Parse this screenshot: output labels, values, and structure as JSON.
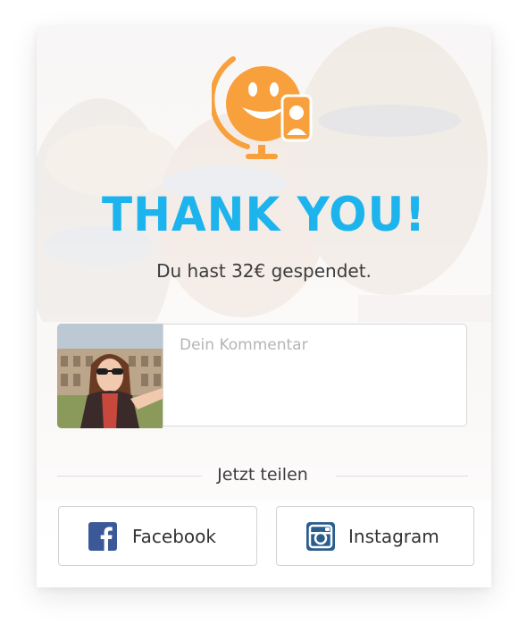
{
  "header": {
    "title": "THANK YOU!",
    "donation_text": "Du hast 32€ gespendet."
  },
  "comment": {
    "placeholder": "Dein Kommentar",
    "value": ""
  },
  "share": {
    "label": "Jetzt teilen",
    "facebook_label": "Facebook",
    "instagram_label": "Instagram"
  },
  "colors": {
    "title": "#1db4ee",
    "logo": "#f7a03c",
    "facebook": "#3b5998",
    "instagram": "#2a5e8e"
  },
  "icons": {
    "logo": "globe-smiley-phone-logo",
    "facebook": "facebook-icon",
    "instagram": "instagram-icon"
  }
}
